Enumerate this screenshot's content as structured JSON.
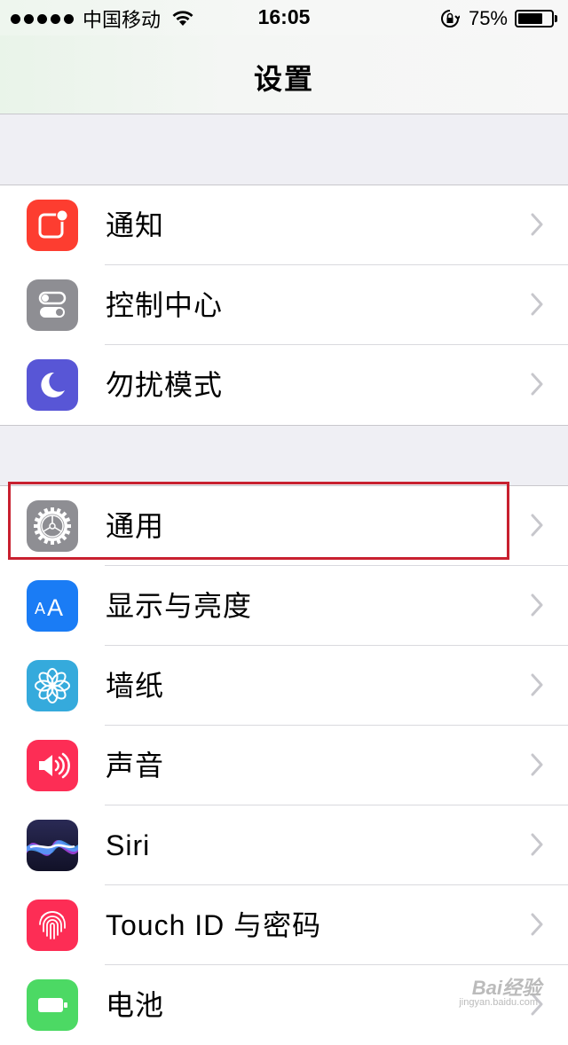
{
  "status_bar": {
    "signal_icon": "signal-dots-icon",
    "carrier": "中国移动",
    "wifi_icon": "wifi-icon",
    "time": "16:05",
    "rotation_lock_icon": "rotation-lock-icon",
    "battery_percent": "75%",
    "battery_level": 0.75,
    "battery_icon": "battery-icon"
  },
  "nav": {
    "title": "设置"
  },
  "groups": [
    {
      "items": [
        {
          "label": "通知",
          "icon": "notifications-icon",
          "icon_color": "#fd3d30"
        },
        {
          "label": "控制中心",
          "icon": "control-center-icon",
          "icon_color": "#8e8e93"
        },
        {
          "label": "勿扰模式",
          "icon": "do-not-disturb-moon-icon",
          "icon_color": "#5856d6"
        }
      ]
    },
    {
      "items": [
        {
          "label": "通用",
          "icon": "general-gear-icon",
          "icon_color": "#8e8e93",
          "highlighted": true
        },
        {
          "label": "显示与亮度",
          "icon": "display-brightness-aa-icon",
          "icon_color": "#1a7cf5"
        },
        {
          "label": "墙纸",
          "icon": "wallpaper-flower-icon",
          "icon_color": "#35aadc"
        },
        {
          "label": "声音",
          "icon": "sounds-speaker-icon",
          "icon_color": "#fd2d55"
        },
        {
          "label": "Siri",
          "icon": "siri-icon",
          "icon_color": "#1c1c3a"
        },
        {
          "label": "Touch ID 与密码",
          "icon": "touch-id-fingerprint-icon",
          "icon_color": "#fd2d55"
        },
        {
          "label": "电池",
          "icon": "battery-settings-icon",
          "icon_color": "#4cd964"
        }
      ]
    }
  ],
  "chevron_icon": "chevron-right-icon",
  "highlight_color": "#c8202f",
  "watermark": "Bai经验",
  "watermark_sub": "jingyan.baidu.com"
}
